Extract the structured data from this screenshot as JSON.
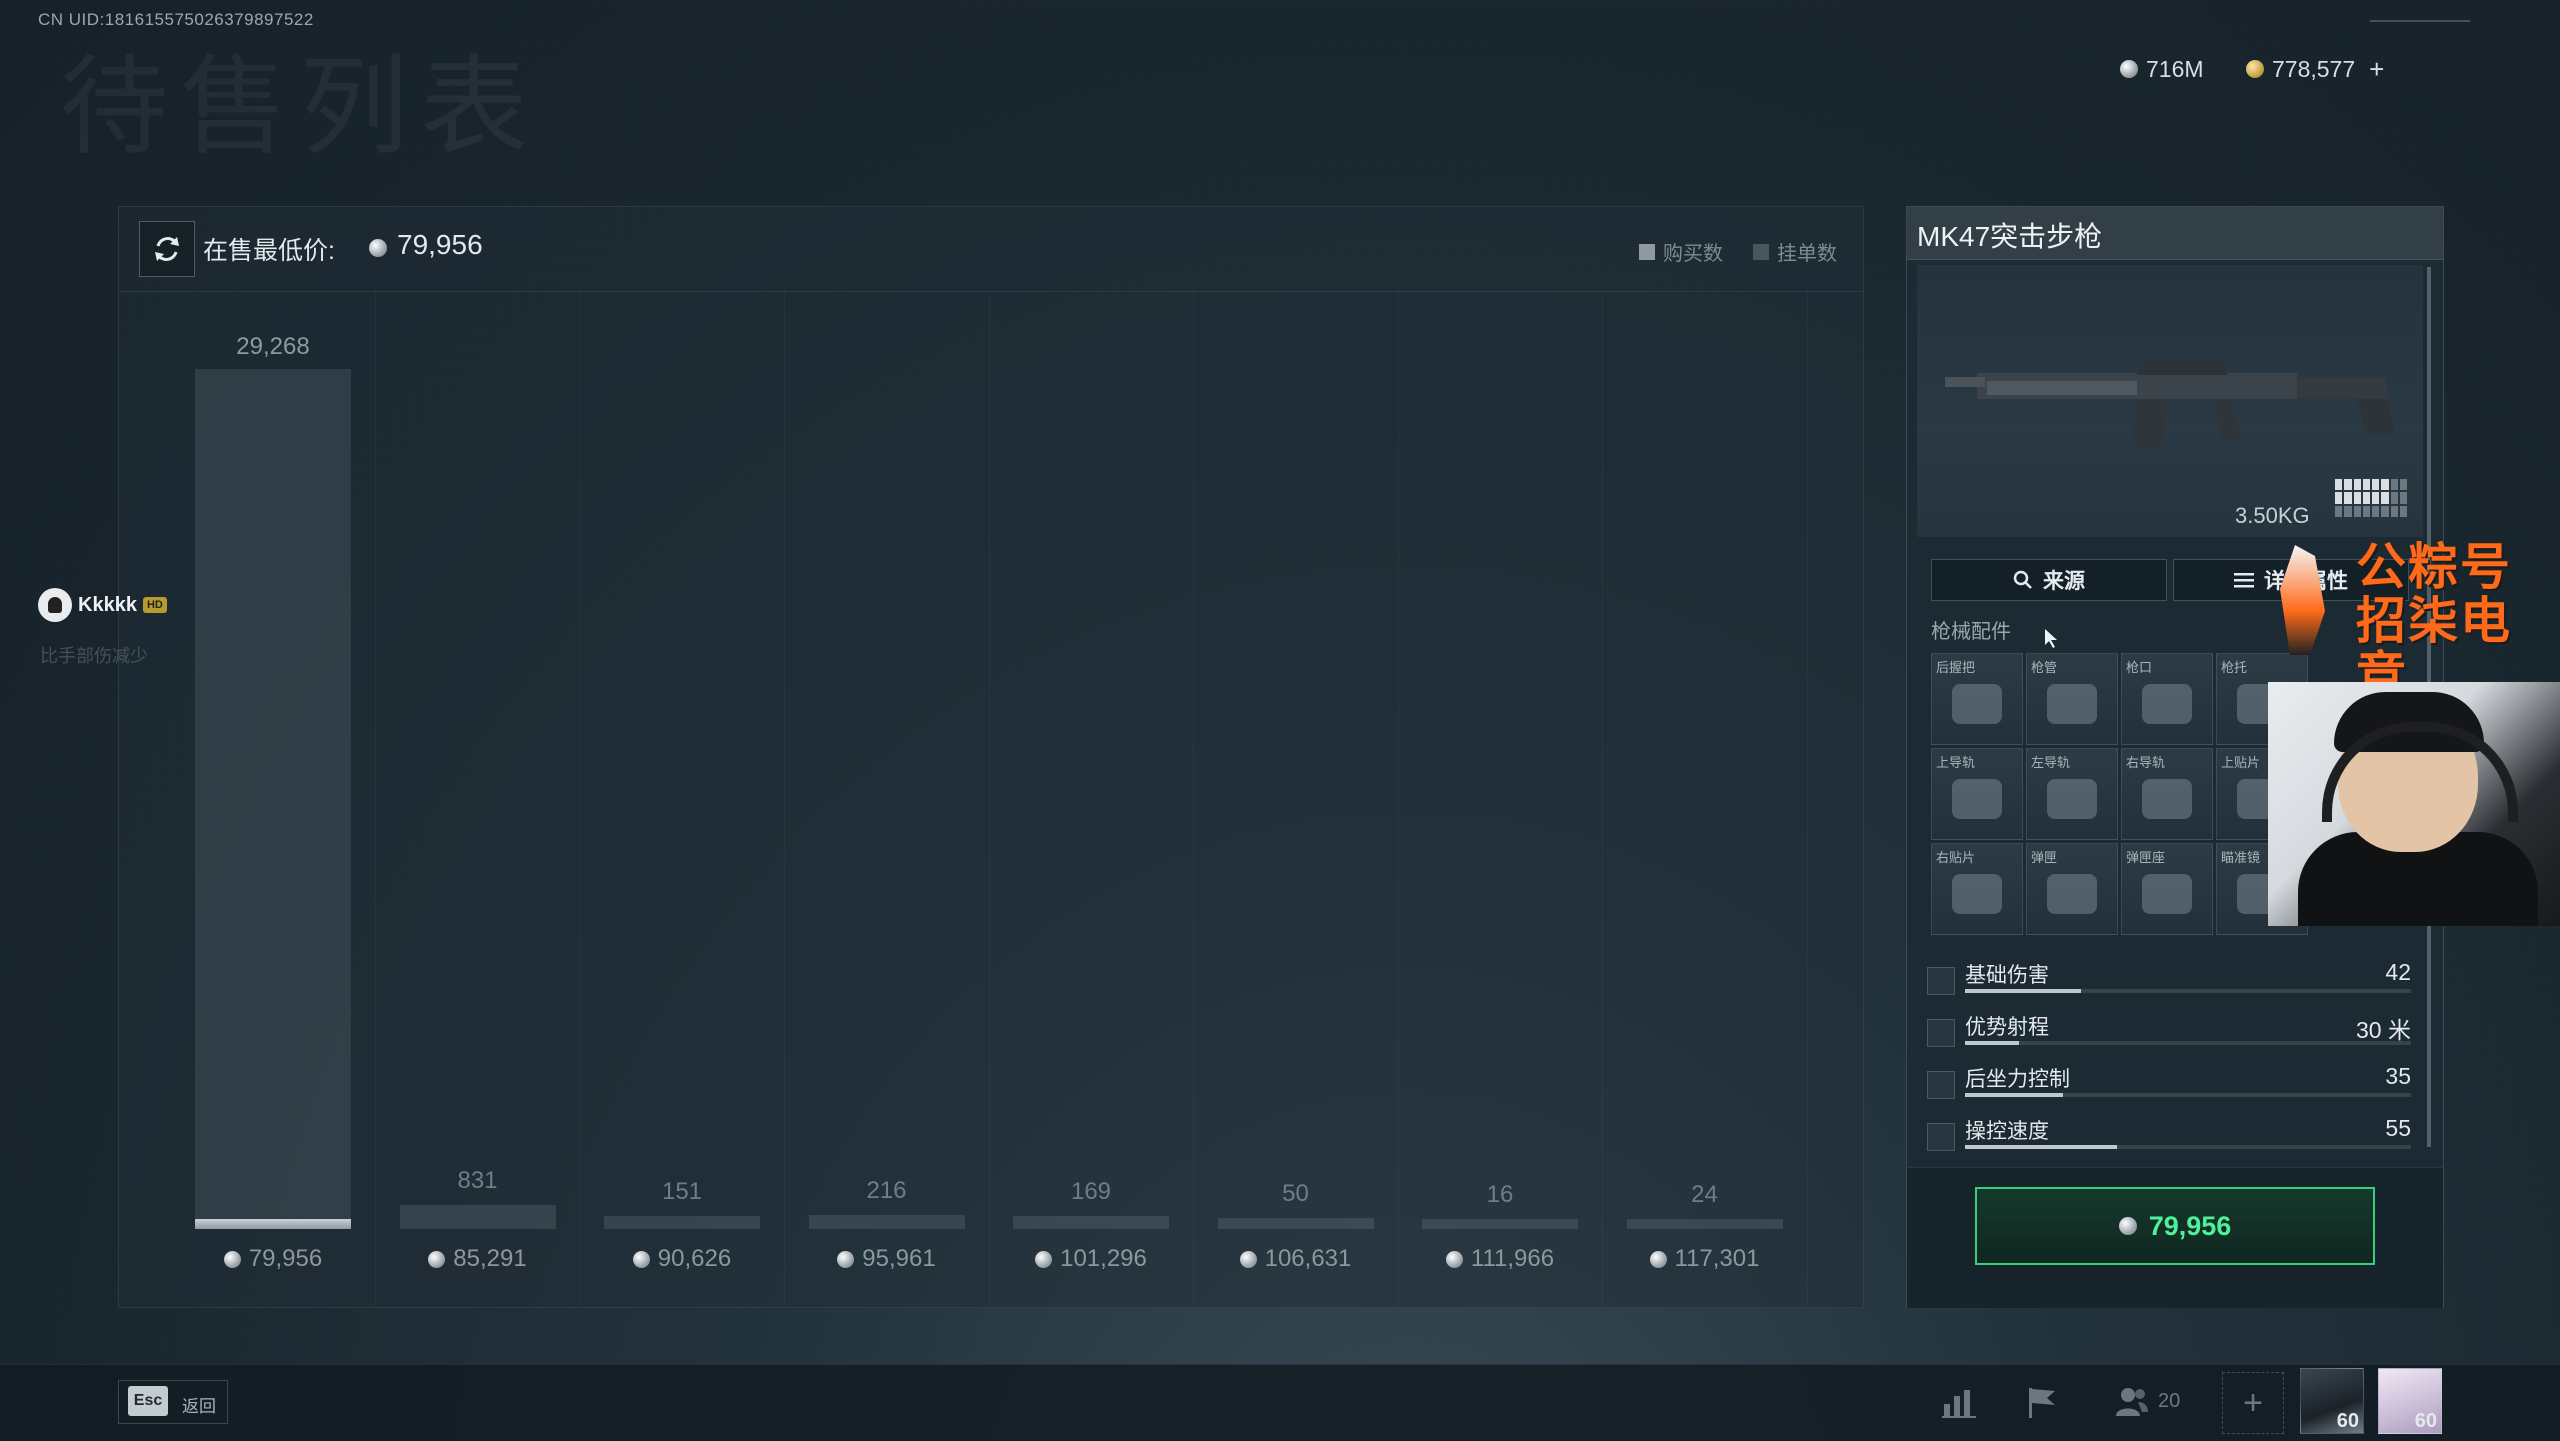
{
  "header": {
    "uid": "CN UID:181615575026379897522",
    "bg_title": "待售列表",
    "currency": {
      "silver": "716M",
      "gold": "778,577",
      "add": "+"
    }
  },
  "chart": {
    "lowest_label": "在售最低价:",
    "lowest_value": "79,956",
    "legend": [
      {
        "label": "购买数",
        "color": "#8f999f"
      },
      {
        "label": "挂单数",
        "color": "#4a565d"
      }
    ]
  },
  "chart_data": {
    "type": "bar",
    "title": "",
    "xlabel": "",
    "ylabel": "",
    "categories": [
      "79,956",
      "85,291",
      "90,626",
      "95,961",
      "101,296",
      "106,631",
      "111,966",
      "117,301"
    ],
    "values": [
      29268,
      831,
      151,
      216,
      169,
      50,
      16,
      24
    ],
    "value_labels": [
      "29,268",
      "831",
      "151",
      "216",
      "169",
      "50",
      "16",
      "24"
    ],
    "ylim": [
      0,
      29268
    ],
    "grid": true
  },
  "side_user": {
    "name": "Kkkkk",
    "badge": "HD",
    "sub": "比手部伤减少"
  },
  "item": {
    "title": "MK47突击步枪",
    "weight": "3.50KG",
    "tabs": {
      "source": "来源",
      "details": "详细属性"
    },
    "section": "枪械配件",
    "attachments": [
      "后握把",
      "枪管",
      "枪口",
      "枪托",
      "上导轨",
      "左导轨",
      "右导轨",
      "上贴片",
      "右贴片",
      "弹匣",
      "弹匣座",
      "瞄准镜"
    ],
    "stats": [
      {
        "name": "基础伤害",
        "value": "42",
        "ratio": 0.26
      },
      {
        "name": "优势射程",
        "value": "30 米",
        "ratio": 0.12
      },
      {
        "name": "后坐力控制",
        "value": "35",
        "ratio": 0.22
      },
      {
        "name": "操控速度",
        "value": "55",
        "ratio": 0.34
      }
    ],
    "buy_price": "79,956"
  },
  "overlay": {
    "watermark_line1": "公粽号",
    "watermark_line2": "招柒电竞"
  },
  "bottom": {
    "esc_key": "Esc",
    "esc_label": "返回",
    "friends_count": "20",
    "add": "+",
    "party": [
      {
        "level": "60"
      },
      {
        "level": "60"
      }
    ]
  }
}
